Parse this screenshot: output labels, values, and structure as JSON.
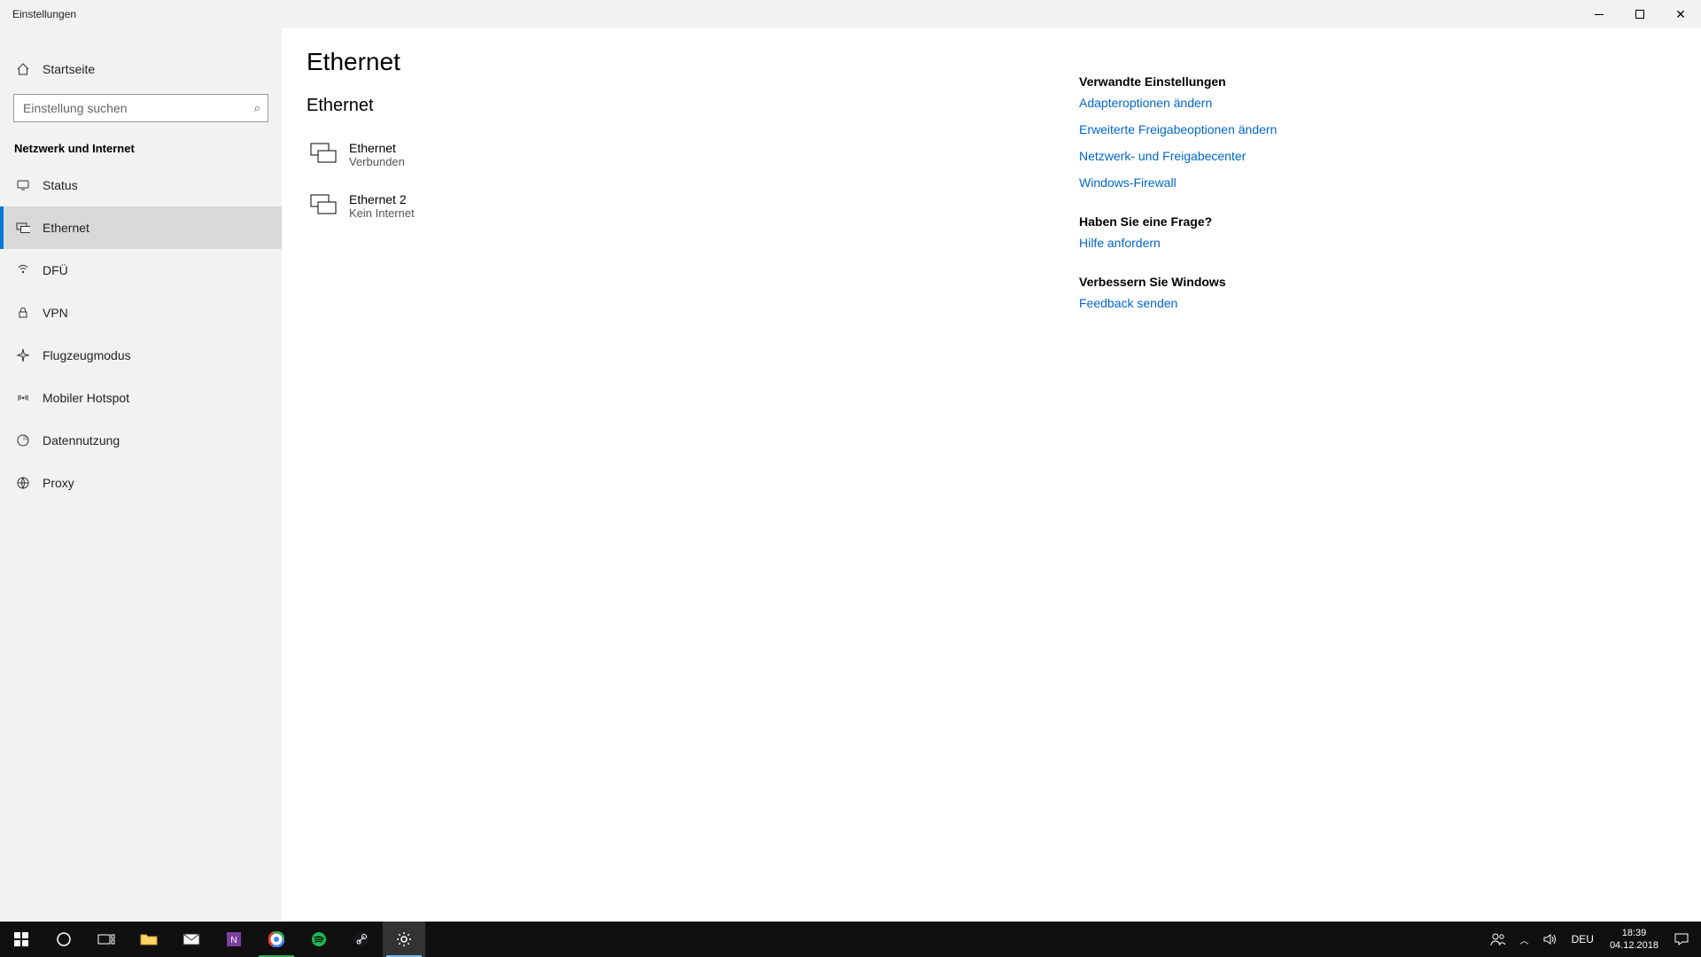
{
  "window": {
    "title": "Einstellungen"
  },
  "sidebar": {
    "home_label": "Startseite",
    "search_placeholder": "Einstellung suchen",
    "category_label": "Netzwerk und Internet",
    "items": [
      {
        "id": "status",
        "label": "Status",
        "icon": "status-icon"
      },
      {
        "id": "ethernet",
        "label": "Ethernet",
        "icon": "ethernet-icon",
        "active": true
      },
      {
        "id": "dfu",
        "label": "DFÜ",
        "icon": "dialup-icon"
      },
      {
        "id": "vpn",
        "label": "VPN",
        "icon": "vpn-icon"
      },
      {
        "id": "airplane",
        "label": "Flugzeugmodus",
        "icon": "airplane-icon"
      },
      {
        "id": "hotspot",
        "label": "Mobiler Hotspot",
        "icon": "hotspot-icon"
      },
      {
        "id": "datausage",
        "label": "Datennutzung",
        "icon": "datausage-icon"
      },
      {
        "id": "proxy",
        "label": "Proxy",
        "icon": "proxy-icon"
      }
    ]
  },
  "page": {
    "title": "Ethernet",
    "section_heading": "Ethernet",
    "connections": [
      {
        "name": "Ethernet",
        "status": "Verbunden"
      },
      {
        "name": "Ethernet 2",
        "status": "Kein Internet"
      }
    ]
  },
  "related": {
    "heading": "Verwandte Einstellungen",
    "links": [
      "Adapteroptionen ändern",
      "Erweiterte Freigabeoptionen ändern",
      "Netzwerk- und Freigabecenter",
      "Windows-Firewall"
    ]
  },
  "help": {
    "heading": "Haben Sie eine Frage?",
    "link": "Hilfe anfordern"
  },
  "feedback": {
    "heading": "Verbessern Sie Windows",
    "link": "Feedback senden"
  },
  "taskbar": {
    "lang": "DEU",
    "time": "18:39",
    "date": "04.12.2018"
  }
}
